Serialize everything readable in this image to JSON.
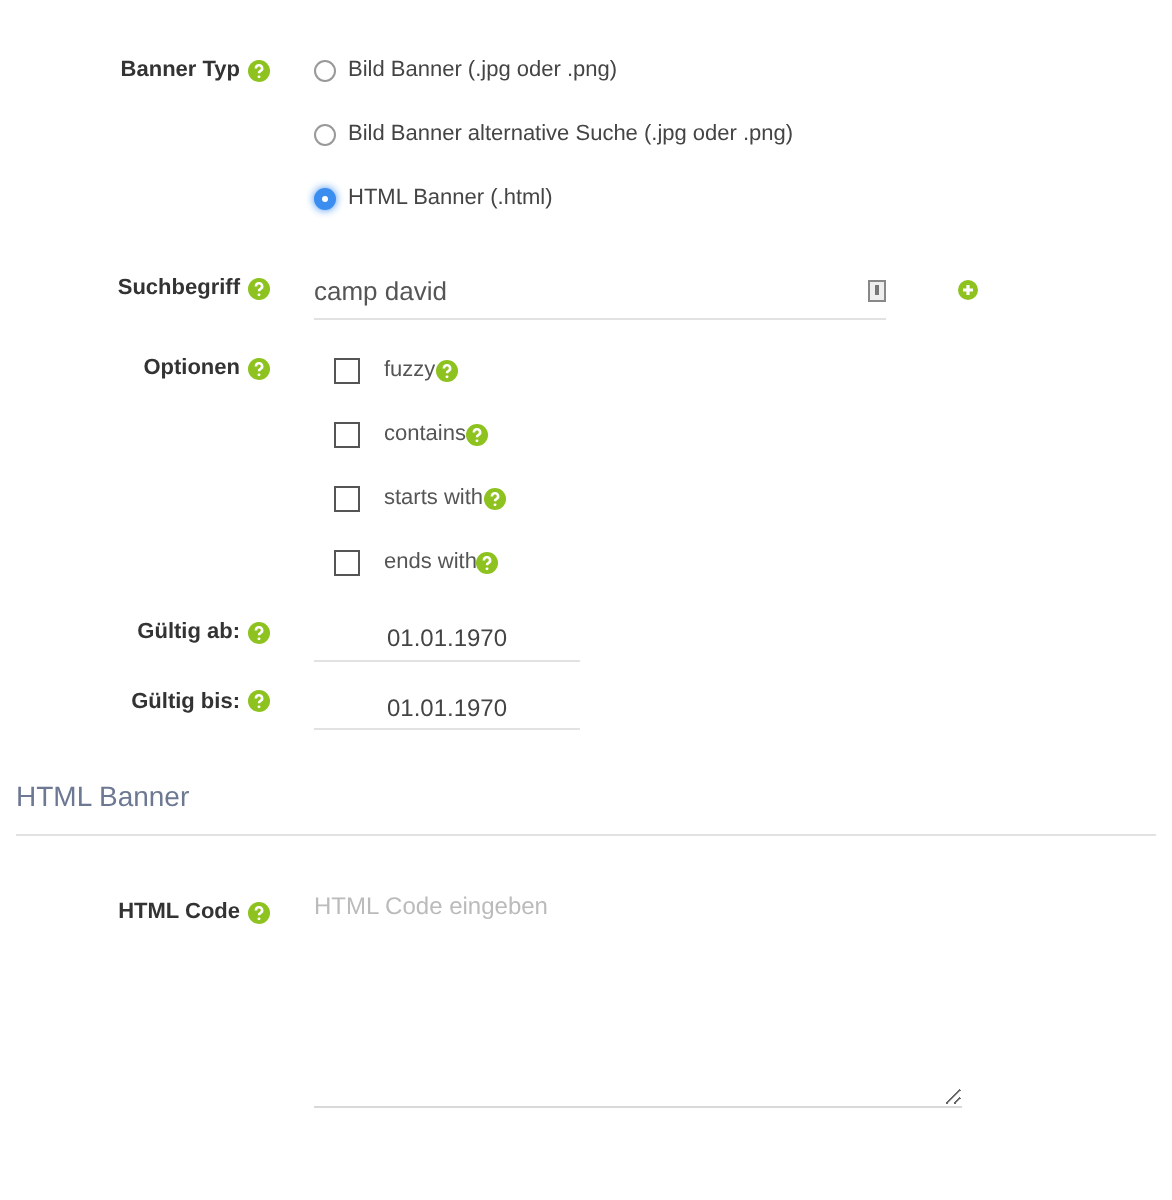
{
  "banner_type": {
    "label": "Banner Typ",
    "options": [
      {
        "label": "Bild Banner (.jpg oder .png)",
        "selected": false
      },
      {
        "label": "Bild Banner alternative Suche (.jpg oder .png)",
        "selected": false
      },
      {
        "label": "HTML Banner (.html)",
        "selected": true
      }
    ]
  },
  "search_term": {
    "label": "Suchbegriff",
    "value": "camp david"
  },
  "options": {
    "label": "Optionen",
    "items": [
      {
        "label": "fuzzy",
        "checked": false
      },
      {
        "label": "contains",
        "checked": false
      },
      {
        "label": "starts with",
        "checked": false
      },
      {
        "label": "ends with",
        "checked": false
      }
    ]
  },
  "valid_from": {
    "label": "Gültig ab:",
    "value": "01.01.1970"
  },
  "valid_to": {
    "label": "Gültig bis:",
    "value": "01.01.1970"
  },
  "section_title": "HTML Banner",
  "html_code": {
    "label": "HTML Code",
    "placeholder": "HTML Code eingeben"
  }
}
